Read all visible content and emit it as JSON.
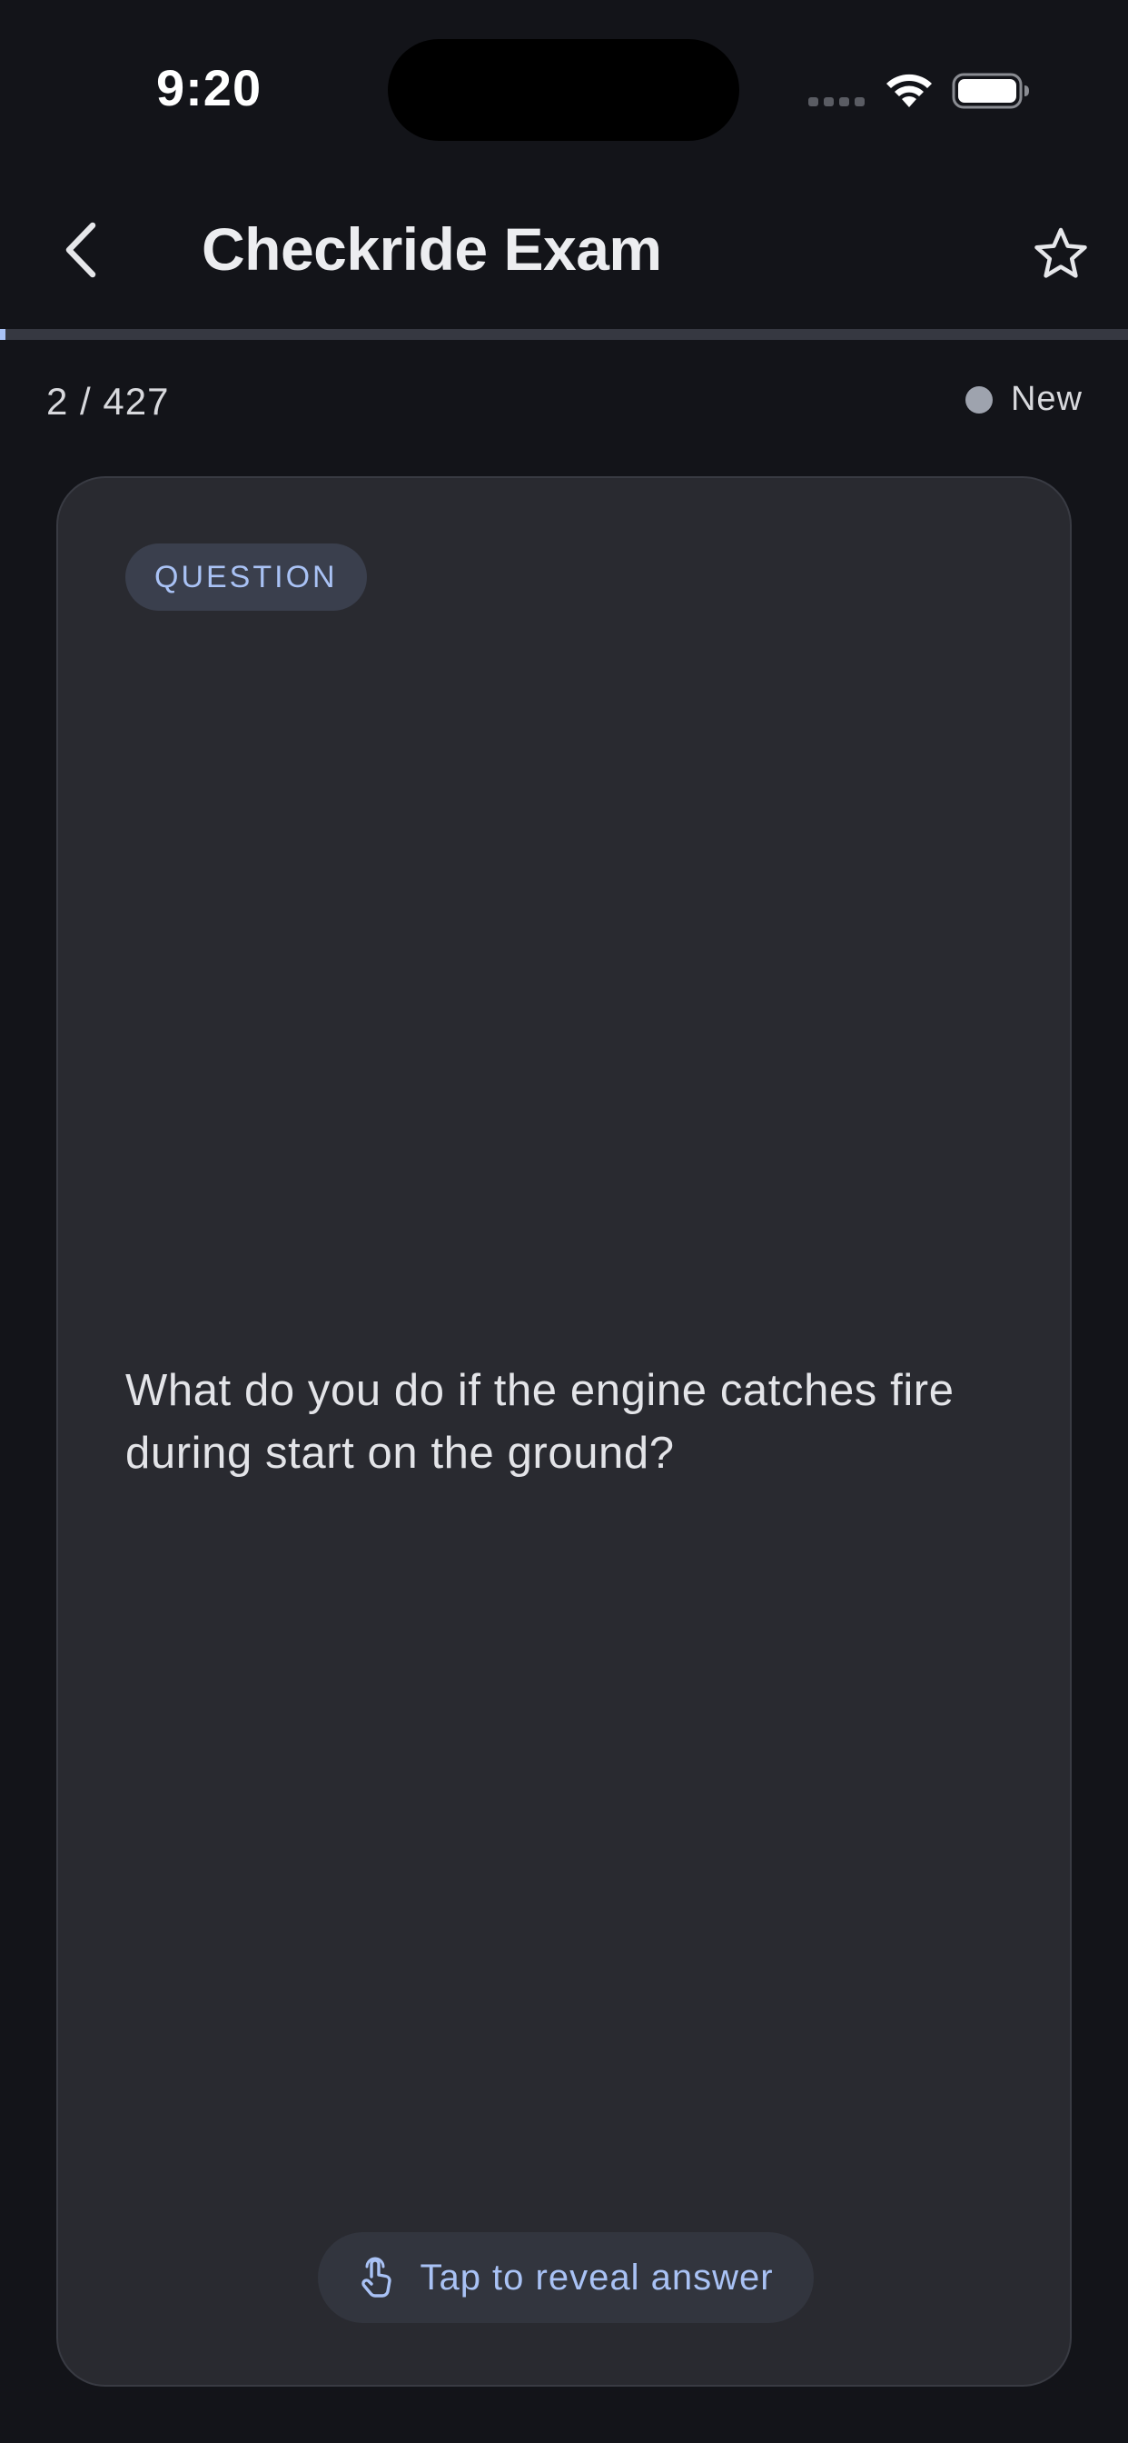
{
  "status_bar": {
    "time": "9:20"
  },
  "nav": {
    "title": "Checkride Exam"
  },
  "progress": {
    "current": 2,
    "total": 427,
    "fraction": 0.004685,
    "label": "2 / 427"
  },
  "card_status": {
    "label": "New",
    "dot_color": "#9ea3ae"
  },
  "card": {
    "tag": "QUESTION",
    "question": "What do you do if the engine catches fire during start on the ground?",
    "reveal_label": "Tap to reveal answer"
  },
  "colors": {
    "background": "#131419",
    "card": "#292a30",
    "accent": "#a9c2f5",
    "text": "#e6e7ea"
  },
  "icons": {
    "back": "chevron-left-icon",
    "favorite": "star-outline-icon",
    "reveal": "tap-hand-icon"
  }
}
